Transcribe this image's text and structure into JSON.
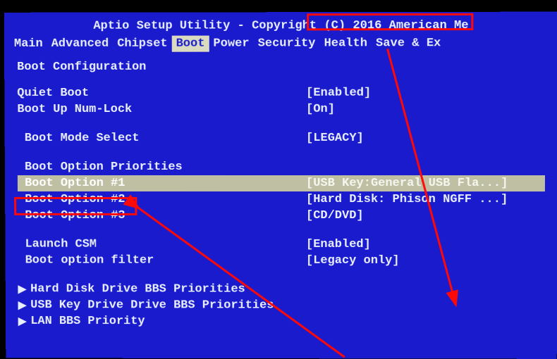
{
  "title": {
    "app": "Aptio Setup Utility",
    "sep": " - ",
    "copyright": "Copyright (C) 2016",
    "tail": " American Me"
  },
  "menu": {
    "items": [
      "Main",
      "Advanced",
      "Chipset",
      "Boot",
      "Power",
      "Security",
      "Health",
      "Save & Ex"
    ],
    "active_index": 3
  },
  "content": {
    "section": "Boot Configuration",
    "rows": [
      {
        "label": "Quiet Boot",
        "value": "[Enabled]"
      },
      {
        "label": "Boot Up Num-Lock",
        "value": "[On]"
      }
    ],
    "mode": {
      "label": " Boot Mode Select",
      "value": "[LEGACY]"
    },
    "priorities_header": " Boot Option Priorities",
    "boot_options": [
      {
        "label": " Boot Option #1",
        "value": "[USB Key:General USB Fla...]",
        "selected": true
      },
      {
        "label": " Boot Option #2",
        "value": "[Hard Disk: Phison NGFF ...]"
      },
      {
        "label": " Boot Option #3",
        "value": "[CD/DVD]"
      }
    ],
    "csm": [
      {
        "label": " Launch CSM",
        "value": "[Enabled]"
      },
      {
        "label": " Boot option filter",
        "value": "[Legacy only]"
      }
    ],
    "submenus": [
      "Hard Disk Drive BBS Priorities",
      "USB Key Drive Drive BBS Priorities",
      "LAN BBS Priority"
    ]
  }
}
